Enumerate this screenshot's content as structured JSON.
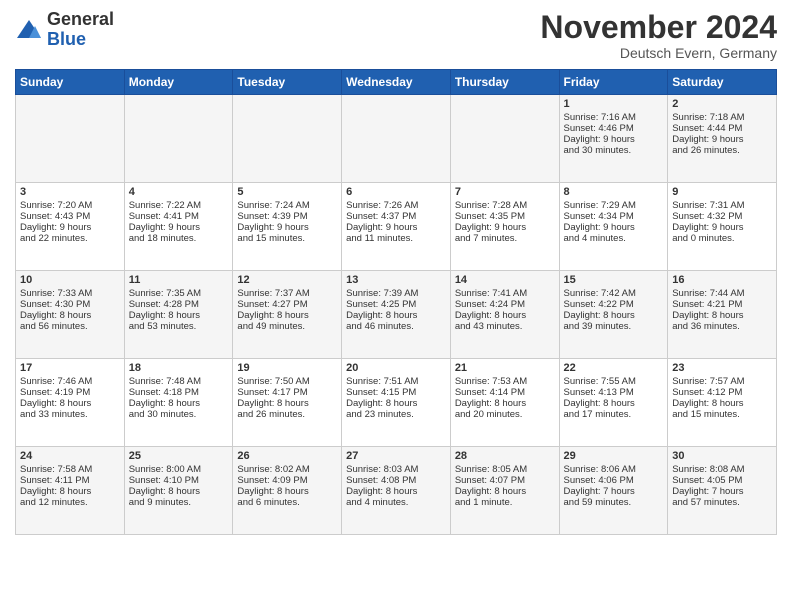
{
  "logo": {
    "general": "General",
    "blue": "Blue"
  },
  "header": {
    "month": "November 2024",
    "location": "Deutsch Evern, Germany"
  },
  "weekdays": [
    "Sunday",
    "Monday",
    "Tuesday",
    "Wednesday",
    "Thursday",
    "Friday",
    "Saturday"
  ],
  "weeks": [
    [
      {
        "day": "",
        "info": ""
      },
      {
        "day": "",
        "info": ""
      },
      {
        "day": "",
        "info": ""
      },
      {
        "day": "",
        "info": ""
      },
      {
        "day": "",
        "info": ""
      },
      {
        "day": "1",
        "info": "Sunrise: 7:16 AM\nSunset: 4:46 PM\nDaylight: 9 hours\nand 30 minutes."
      },
      {
        "day": "2",
        "info": "Sunrise: 7:18 AM\nSunset: 4:44 PM\nDaylight: 9 hours\nand 26 minutes."
      }
    ],
    [
      {
        "day": "3",
        "info": "Sunrise: 7:20 AM\nSunset: 4:43 PM\nDaylight: 9 hours\nand 22 minutes."
      },
      {
        "day": "4",
        "info": "Sunrise: 7:22 AM\nSunset: 4:41 PM\nDaylight: 9 hours\nand 18 minutes."
      },
      {
        "day": "5",
        "info": "Sunrise: 7:24 AM\nSunset: 4:39 PM\nDaylight: 9 hours\nand 15 minutes."
      },
      {
        "day": "6",
        "info": "Sunrise: 7:26 AM\nSunset: 4:37 PM\nDaylight: 9 hours\nand 11 minutes."
      },
      {
        "day": "7",
        "info": "Sunrise: 7:28 AM\nSunset: 4:35 PM\nDaylight: 9 hours\nand 7 minutes."
      },
      {
        "day": "8",
        "info": "Sunrise: 7:29 AM\nSunset: 4:34 PM\nDaylight: 9 hours\nand 4 minutes."
      },
      {
        "day": "9",
        "info": "Sunrise: 7:31 AM\nSunset: 4:32 PM\nDaylight: 9 hours\nand 0 minutes."
      }
    ],
    [
      {
        "day": "10",
        "info": "Sunrise: 7:33 AM\nSunset: 4:30 PM\nDaylight: 8 hours\nand 56 minutes."
      },
      {
        "day": "11",
        "info": "Sunrise: 7:35 AM\nSunset: 4:28 PM\nDaylight: 8 hours\nand 53 minutes."
      },
      {
        "day": "12",
        "info": "Sunrise: 7:37 AM\nSunset: 4:27 PM\nDaylight: 8 hours\nand 49 minutes."
      },
      {
        "day": "13",
        "info": "Sunrise: 7:39 AM\nSunset: 4:25 PM\nDaylight: 8 hours\nand 46 minutes."
      },
      {
        "day": "14",
        "info": "Sunrise: 7:41 AM\nSunset: 4:24 PM\nDaylight: 8 hours\nand 43 minutes."
      },
      {
        "day": "15",
        "info": "Sunrise: 7:42 AM\nSunset: 4:22 PM\nDaylight: 8 hours\nand 39 minutes."
      },
      {
        "day": "16",
        "info": "Sunrise: 7:44 AM\nSunset: 4:21 PM\nDaylight: 8 hours\nand 36 minutes."
      }
    ],
    [
      {
        "day": "17",
        "info": "Sunrise: 7:46 AM\nSunset: 4:19 PM\nDaylight: 8 hours\nand 33 minutes."
      },
      {
        "day": "18",
        "info": "Sunrise: 7:48 AM\nSunset: 4:18 PM\nDaylight: 8 hours\nand 30 minutes."
      },
      {
        "day": "19",
        "info": "Sunrise: 7:50 AM\nSunset: 4:17 PM\nDaylight: 8 hours\nand 26 minutes."
      },
      {
        "day": "20",
        "info": "Sunrise: 7:51 AM\nSunset: 4:15 PM\nDaylight: 8 hours\nand 23 minutes."
      },
      {
        "day": "21",
        "info": "Sunrise: 7:53 AM\nSunset: 4:14 PM\nDaylight: 8 hours\nand 20 minutes."
      },
      {
        "day": "22",
        "info": "Sunrise: 7:55 AM\nSunset: 4:13 PM\nDaylight: 8 hours\nand 17 minutes."
      },
      {
        "day": "23",
        "info": "Sunrise: 7:57 AM\nSunset: 4:12 PM\nDaylight: 8 hours\nand 15 minutes."
      }
    ],
    [
      {
        "day": "24",
        "info": "Sunrise: 7:58 AM\nSunset: 4:11 PM\nDaylight: 8 hours\nand 12 minutes."
      },
      {
        "day": "25",
        "info": "Sunrise: 8:00 AM\nSunset: 4:10 PM\nDaylight: 8 hours\nand 9 minutes."
      },
      {
        "day": "26",
        "info": "Sunrise: 8:02 AM\nSunset: 4:09 PM\nDaylight: 8 hours\nand 6 minutes."
      },
      {
        "day": "27",
        "info": "Sunrise: 8:03 AM\nSunset: 4:08 PM\nDaylight: 8 hours\nand 4 minutes."
      },
      {
        "day": "28",
        "info": "Sunrise: 8:05 AM\nSunset: 4:07 PM\nDaylight: 8 hours\nand 1 minute."
      },
      {
        "day": "29",
        "info": "Sunrise: 8:06 AM\nSunset: 4:06 PM\nDaylight: 7 hours\nand 59 minutes."
      },
      {
        "day": "30",
        "info": "Sunrise: 8:08 AM\nSunset: 4:05 PM\nDaylight: 7 hours\nand 57 minutes."
      }
    ]
  ]
}
